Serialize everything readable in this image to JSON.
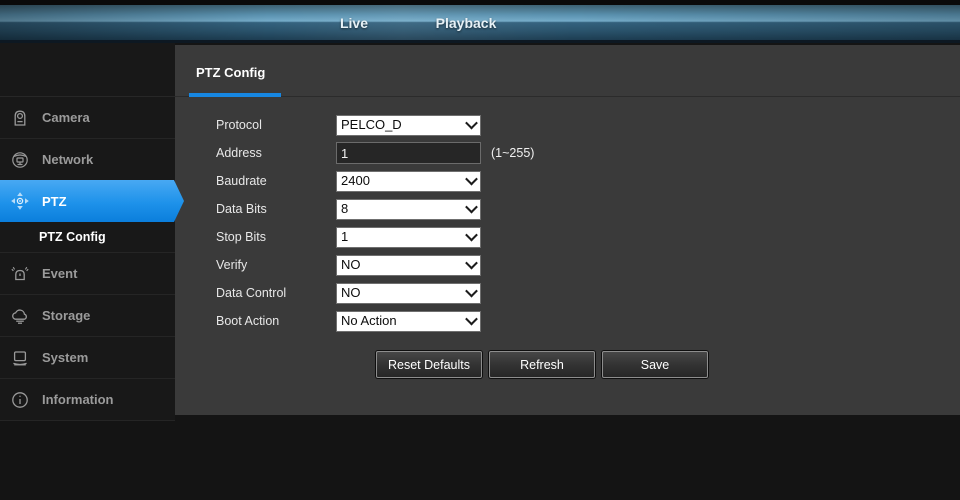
{
  "header": {
    "tabs": {
      "live": "Live",
      "playback": "Playback"
    }
  },
  "sidebar": {
    "items": [
      {
        "label": "Camera",
        "icon": "camera-icon"
      },
      {
        "label": "Network",
        "icon": "network-icon"
      },
      {
        "label": "PTZ",
        "icon": "ptz-icon",
        "active": true
      },
      {
        "label": "Event",
        "icon": "event-icon"
      },
      {
        "label": "Storage",
        "icon": "storage-icon"
      },
      {
        "label": "System",
        "icon": "system-icon"
      },
      {
        "label": "Information",
        "icon": "information-icon"
      }
    ],
    "sub_item": {
      "label": "PTZ Config",
      "active": true
    }
  },
  "main": {
    "tab_title": "PTZ Config",
    "form": {
      "rows": [
        {
          "label": "Protocol",
          "type": "select",
          "value": "PELCO_D"
        },
        {
          "label": "Address",
          "type": "input",
          "value": "1",
          "hint": "(1~255)"
        },
        {
          "label": "Baudrate",
          "type": "select",
          "value": "2400"
        },
        {
          "label": "Data Bits",
          "type": "select",
          "value": "8"
        },
        {
          "label": "Stop Bits",
          "type": "select",
          "value": "1"
        },
        {
          "label": "Verify",
          "type": "select",
          "value": "NO"
        },
        {
          "label": "Data Control",
          "type": "select",
          "value": "NO"
        },
        {
          "label": "Boot Action",
          "type": "select",
          "value": "No Action"
        }
      ]
    },
    "buttons": {
      "reset": "Reset Defaults",
      "refresh": "Refresh",
      "save": "Save"
    }
  },
  "colors": {
    "accent_blue": "#1787e2",
    "selected_item_blue": "#1e92ea",
    "content_bg": "#3a3a3a",
    "sidebar_bg": "#181818",
    "topbar_blue_light": "#74abc8",
    "topbar_blue_dark": "#1d3d52"
  }
}
